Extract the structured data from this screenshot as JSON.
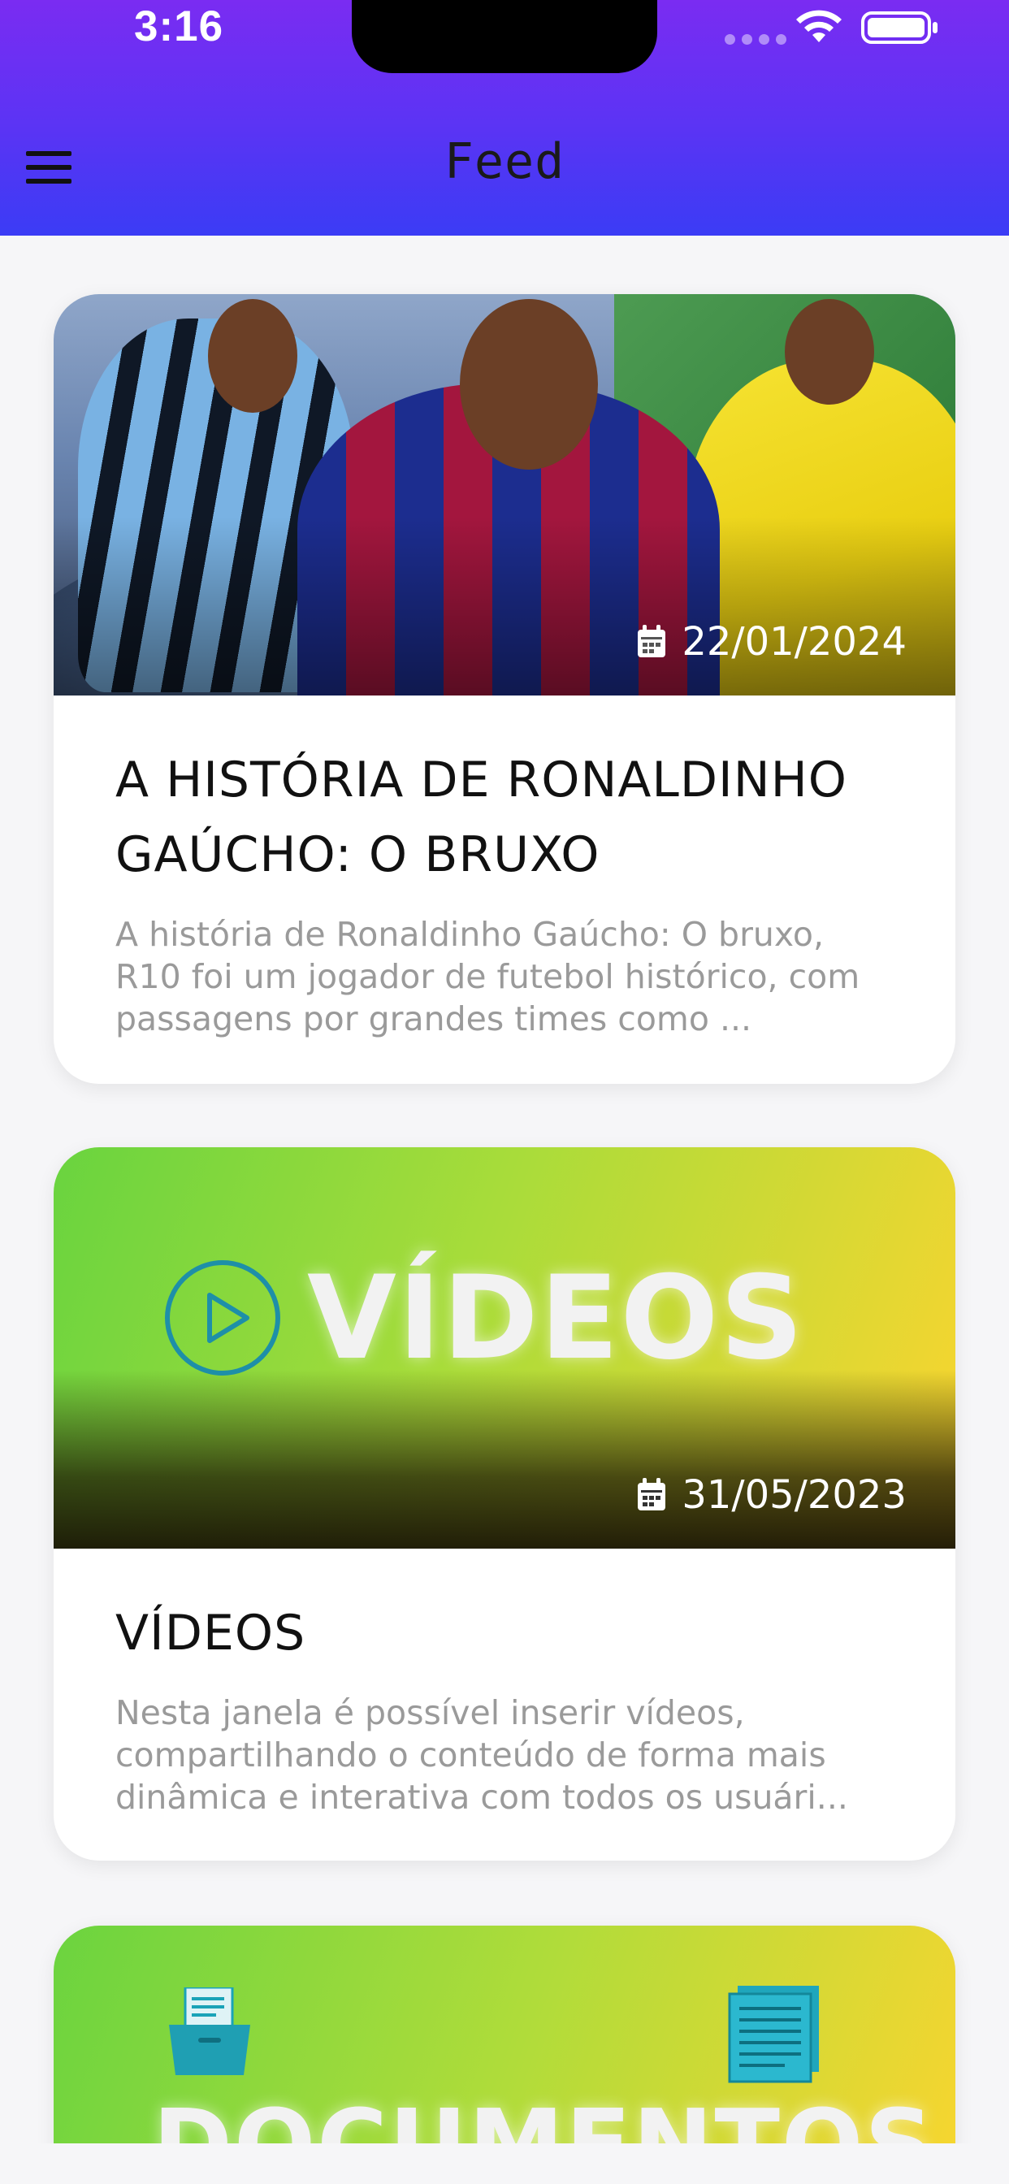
{
  "status_bar": {
    "time": "3:16",
    "icons": [
      "signal-dots-icon",
      "wifi-icon",
      "battery-icon"
    ]
  },
  "header": {
    "title": "Feed",
    "menu_icon": "hamburger-menu-icon",
    "gradient_colors": [
      "#7a2cf2",
      "#3b3cf5"
    ]
  },
  "feed": {
    "posts": [
      {
        "date": "22/01/2024",
        "title": "A HISTÓRIA DE RONALDINHO GAÚCHO: O BRUXO",
        "excerpt": "A história de Ronaldinho Gaúcho: O bruxo, R10 foi um jogador de futebol histórico, com passagens por grandes times como ...",
        "image_icon": "football-photo"
      },
      {
        "date": "31/05/2023",
        "title": "VÍDEOS",
        "excerpt": "Nesta janela é possível inserir vídeos, compartilhando o conteúdo de forma mais dinâmica e interativa com todos os usuári...",
        "banner_text": "VÍDEOS",
        "banner_icon": "play-circle-icon"
      },
      {
        "banner_text": "DOCUMENTOS",
        "banner_icons": [
          "folder-document-icon",
          "document-pages-icon"
        ]
      }
    ]
  },
  "colors": {
    "background": "#f6f6f8",
    "card": "#ffffff",
    "title_text": "#111111",
    "excerpt_text": "#9a9a9a",
    "banner_gradient": [
      "#69d43f",
      "#fbd52f"
    ]
  }
}
